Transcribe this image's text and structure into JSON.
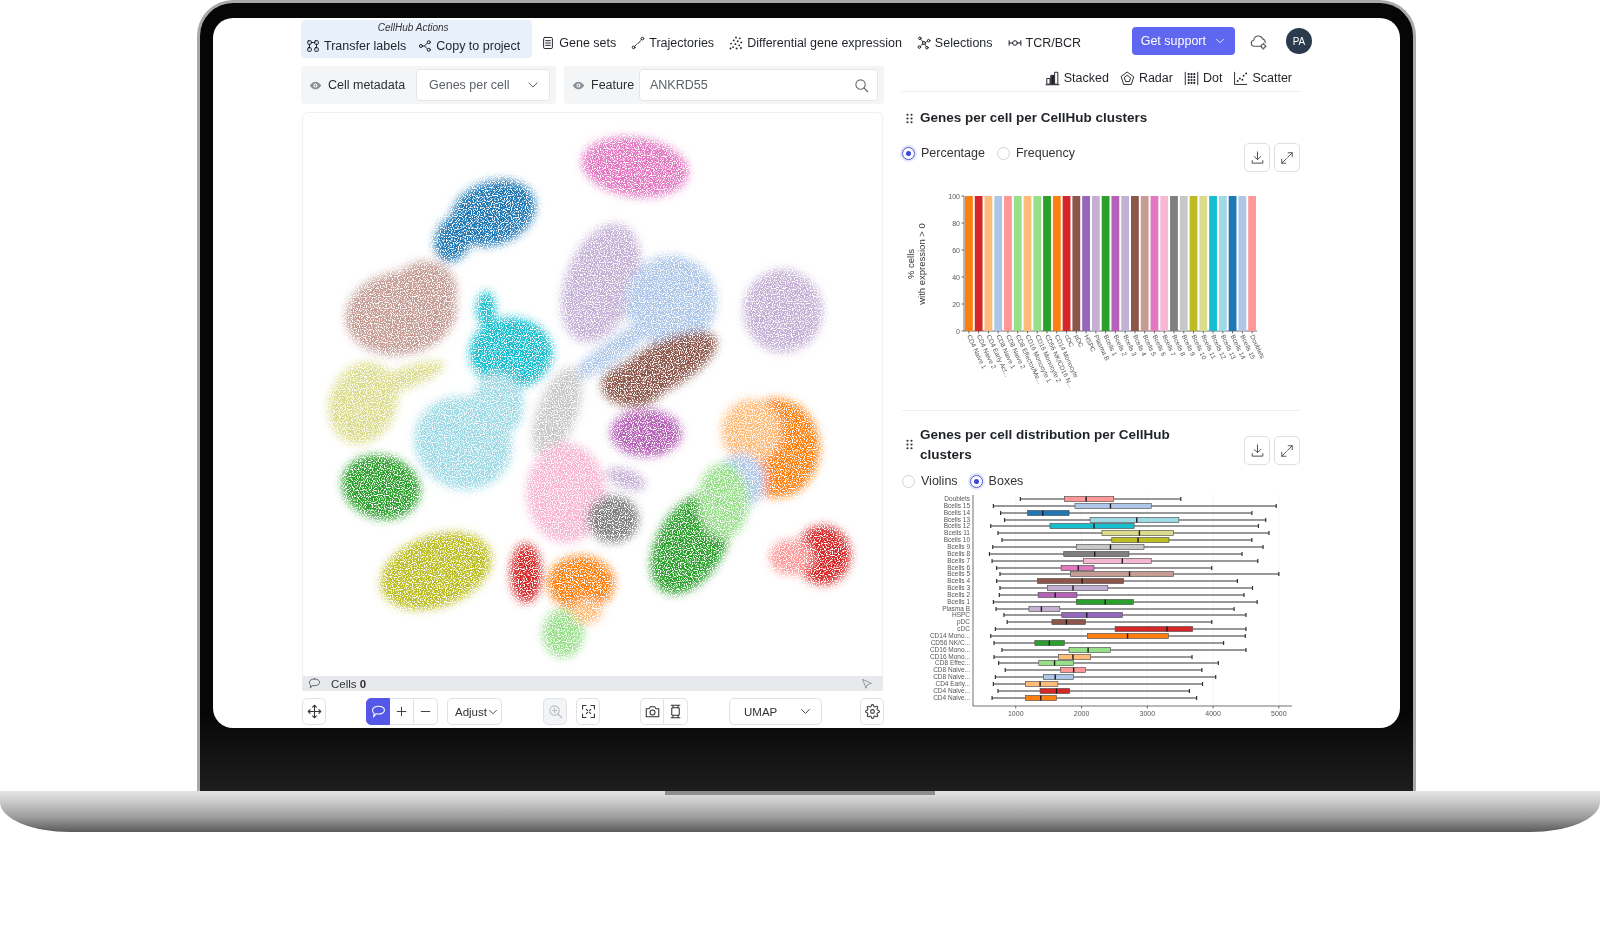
{
  "nav": {
    "group_label": "CellHub Actions",
    "group_items": [
      "Transfer labels",
      "Copy to project"
    ],
    "items": [
      "Gene sets",
      "Trajectories",
      "Differential gene expression",
      "Selections",
      "TCR/BCR"
    ],
    "support_button": "Get support",
    "avatar": "PA"
  },
  "filters": {
    "metadata_label": "Cell metadata",
    "metadata_value": "Genes per cell",
    "feature_label": "Feature",
    "feature_value": "ANKRD55"
  },
  "plot_types": [
    {
      "label": "Stacked",
      "selected": false
    },
    {
      "label": "Radar",
      "selected": false
    },
    {
      "label": "Dot",
      "selected": false
    },
    {
      "label": "Scatter",
      "selected": false
    }
  ],
  "umap": {
    "cells": "Cells **0**"
  },
  "toolbar": {
    "tools": [
      {
        "kind": "move",
        "selected": false
      },
      {
        "kind": "lasso",
        "selected": true
      }
    ],
    "adjust": "Adjust",
    "zoom_disabled": true,
    "embedding": "UMAP"
  },
  "panels": [
    {
      "title": "Genes per cell per CellHub clusters",
      "modes": [
        {
          "label": "Percentage",
          "selected": true
        },
        {
          "label": "Frequency",
          "selected": false
        }
      ],
      "chart_data": {
        "type": "bar",
        "ylabel": "% cells\nwith expression > 0",
        "categories": [
          "CD4 Naive 1",
          "CD4 Naive 2",
          "CD4 Early Act...",
          "CD8 Naive 1",
          "CD8 Naive 2",
          "CD8 Effector/Me...",
          "CD16 Monocyte 1",
          "CD16 Monocyte 2",
          "CD56 NK/CD16 N...",
          "CD14 Monocyte",
          "cDC",
          "pDC",
          "HSPC",
          "Plasma B",
          "Bcells 1",
          "Bcells 2",
          "Bcells 3",
          "Bcells 4",
          "Bcells 5",
          "Bcells 6",
          "Bcells 7",
          "Bcells 8",
          "Bcells 9",
          "Bcells 10",
          "Bcells 11",
          "Bcells 12",
          "Bcells 13",
          "Bcells 14",
          "Bcells 15",
          "Doublets"
        ],
        "values": [
          100,
          100,
          100,
          100,
          100,
          100,
          100,
          100,
          100,
          100,
          100,
          100,
          100,
          100,
          100,
          100,
          100,
          100,
          100,
          100,
          100,
          100,
          100,
          100,
          100,
          100,
          100,
          100,
          100,
          100
        ],
        "colors": [
          "#ff7f0e",
          "#d62728",
          "#ffbb78",
          "#aec7e8",
          "#ff9896",
          "#98df8a",
          "#ffbb78",
          "#98df8a",
          "#2ca02c",
          "#ff7f0e",
          "#d62728",
          "#8c564b",
          "#9467bd",
          "#c5b0d5",
          "#2ca02c",
          "#b661b8",
          "#c5b0d5",
          "#8c564b",
          "#c49c94",
          "#e377c2",
          "#f7b6d2",
          "#7f7f7f",
          "#c7c7c7",
          "#bcbd22",
          "#dbdb8d",
          "#17becf",
          "#9edae5",
          "#1f77b4",
          "#aec7e8",
          "#ff9896"
        ],
        "ylim": [
          0,
          100
        ],
        "yticks": [
          0,
          20,
          40,
          60,
          80,
          100
        ]
      }
    },
    {
      "title": "Genes per cell distribution per CellHub clusters",
      "modes": [
        {
          "label": "Violins",
          "selected": false
        },
        {
          "label": "Boxes",
          "selected": true
        }
      ],
      "chart_data": {
        "type": "box",
        "orientation": "horizontal",
        "categories": [
          "Doublets",
          "Bcells 15",
          "Bcells 14",
          "Bcells 13",
          "Bcells 12",
          "Bcells 11",
          "Bcells 10",
          "Bcells 9",
          "Bcells 8",
          "Bcells 7",
          "Bcells 6",
          "Bcells 5",
          "Bcells 4",
          "Bcells 3",
          "Bcells 2",
          "Bcells 1",
          "Plasma B",
          "HSPC",
          "pDC",
          "cDC",
          "CD14 Mono...",
          "CD56 NK/C...",
          "CD16 Mono...",
          "CD16 Mono...",
          "CD8 Effec...",
          "CD8 Naive...",
          "CD8 Naive...",
          "CD4 Early...",
          "CD4 Naive...",
          "CD4 Naive..."
        ],
        "boxes": [
          {
            "low": 1070,
            "q1": 1740,
            "median": 2070,
            "q3": 2490,
            "high": 3510
          },
          {
            "low": 660,
            "q1": 1900,
            "median": 2440,
            "q3": 3060,
            "high": 4960
          },
          {
            "low": 770,
            "q1": 1180,
            "median": 1410,
            "q3": 1810,
            "high": 4590
          },
          {
            "low": 830,
            "q1": 2130,
            "median": 2840,
            "q3": 3480,
            "high": 4800
          },
          {
            "low": 620,
            "q1": 1520,
            "median": 2190,
            "q3": 2800,
            "high": 4690
          },
          {
            "low": 730,
            "q1": 2310,
            "median": 2880,
            "q3": 3400,
            "high": 4850
          },
          {
            "low": 790,
            "q1": 2460,
            "median": 2860,
            "q3": 3330,
            "high": 4590
          },
          {
            "low": 650,
            "q1": 1920,
            "median": 2440,
            "q3": 2950,
            "high": 4760
          },
          {
            "low": 600,
            "q1": 1730,
            "median": 2200,
            "q3": 2720,
            "high": 4440
          },
          {
            "low": 640,
            "q1": 2030,
            "median": 2620,
            "q3": 3060,
            "high": 4680
          },
          {
            "low": 710,
            "q1": 1690,
            "median": 1950,
            "q3": 2190,
            "high": 3980
          },
          {
            "low": 760,
            "q1": 1830,
            "median": 2730,
            "q3": 3400,
            "high": 5000
          },
          {
            "low": 710,
            "q1": 1330,
            "median": 2010,
            "q3": 2640,
            "high": 4370
          },
          {
            "low": 760,
            "q1": 1480,
            "median": 1870,
            "q3": 2400,
            "high": 4600
          },
          {
            "low": 750,
            "q1": 1340,
            "median": 1600,
            "q3": 1930,
            "high": 4470
          },
          {
            "low": 660,
            "q1": 1920,
            "median": 2360,
            "q3": 2790,
            "high": 4670
          },
          {
            "low": 700,
            "q1": 1200,
            "median": 1390,
            "q3": 1670,
            "high": 4320
          },
          {
            "low": 820,
            "q1": 1700,
            "median": 2080,
            "q3": 2620,
            "high": 4500
          },
          {
            "low": 870,
            "q1": 1550,
            "median": 1770,
            "q3": 2060,
            "high": 3980
          },
          {
            "low": 690,
            "q1": 2510,
            "median": 3300,
            "q3": 3690,
            "high": 4500
          },
          {
            "low": 620,
            "q1": 2090,
            "median": 2700,
            "q3": 3320,
            "high": 4490
          },
          {
            "low": 670,
            "q1": 1290,
            "median": 1510,
            "q3": 1740,
            "high": 4160
          },
          {
            "low": 790,
            "q1": 1810,
            "median": 2100,
            "q3": 2440,
            "high": 4500
          },
          {
            "low": 670,
            "q1": 1650,
            "median": 1870,
            "q3": 2140,
            "high": 3680
          },
          {
            "low": 740,
            "q1": 1350,
            "median": 1590,
            "q3": 1880,
            "high": 4080
          },
          {
            "low": 840,
            "q1": 1680,
            "median": 1880,
            "q3": 2060,
            "high": 3830
          },
          {
            "low": 690,
            "q1": 1420,
            "median": 1600,
            "q3": 1880,
            "high": 4040
          },
          {
            "low": 660,
            "q1": 1150,
            "median": 1370,
            "q3": 1640,
            "high": 3840
          },
          {
            "low": 730,
            "q1": 1370,
            "median": 1620,
            "q3": 1820,
            "high": 3640
          },
          {
            "low": 640,
            "q1": 1150,
            "median": 1380,
            "q3": 1620,
            "high": 3750
          }
        ],
        "colors": [
          "#ff9896",
          "#aec7e8",
          "#1f77b4",
          "#9edae5",
          "#17becf",
          "#dbdb8d",
          "#bcbd22",
          "#c7c7c7",
          "#7f7f7f",
          "#f7b6d2",
          "#e377c2",
          "#c49c94",
          "#8c564b",
          "#c5b0d5",
          "#b661b8",
          "#2ca02c",
          "#c5b0d5",
          "#9467bd",
          "#8c564b",
          "#d62728",
          "#ff7f0e",
          "#2ca02c",
          "#98df8a",
          "#ffbb78",
          "#98df8a",
          "#ff9896",
          "#aec7e8",
          "#ffbb78",
          "#d62728",
          "#ff7f0e"
        ],
        "xlim": [
          350,
          5200
        ],
        "xticks": [
          1000,
          2000,
          3000,
          4000,
          5000
        ],
        "grid": true
      }
    }
  ]
}
